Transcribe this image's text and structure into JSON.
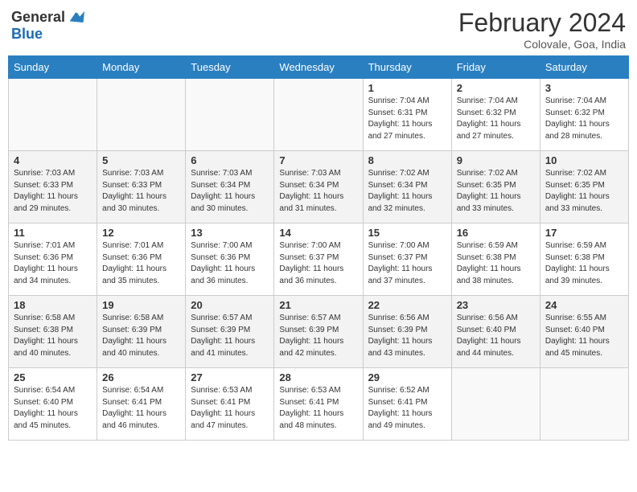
{
  "header": {
    "logo_general": "General",
    "logo_blue": "Blue",
    "month_year": "February 2024",
    "location": "Colovale, Goa, India"
  },
  "days_of_week": [
    "Sunday",
    "Monday",
    "Tuesday",
    "Wednesday",
    "Thursday",
    "Friday",
    "Saturday"
  ],
  "weeks": [
    [
      {
        "day": "",
        "info": ""
      },
      {
        "day": "",
        "info": ""
      },
      {
        "day": "",
        "info": ""
      },
      {
        "day": "",
        "info": ""
      },
      {
        "day": "1",
        "info": "Sunrise: 7:04 AM\nSunset: 6:31 PM\nDaylight: 11 hours and 27 minutes."
      },
      {
        "day": "2",
        "info": "Sunrise: 7:04 AM\nSunset: 6:32 PM\nDaylight: 11 hours and 27 minutes."
      },
      {
        "day": "3",
        "info": "Sunrise: 7:04 AM\nSunset: 6:32 PM\nDaylight: 11 hours and 28 minutes."
      }
    ],
    [
      {
        "day": "4",
        "info": "Sunrise: 7:03 AM\nSunset: 6:33 PM\nDaylight: 11 hours and 29 minutes."
      },
      {
        "day": "5",
        "info": "Sunrise: 7:03 AM\nSunset: 6:33 PM\nDaylight: 11 hours and 30 minutes."
      },
      {
        "day": "6",
        "info": "Sunrise: 7:03 AM\nSunset: 6:34 PM\nDaylight: 11 hours and 30 minutes."
      },
      {
        "day": "7",
        "info": "Sunrise: 7:03 AM\nSunset: 6:34 PM\nDaylight: 11 hours and 31 minutes."
      },
      {
        "day": "8",
        "info": "Sunrise: 7:02 AM\nSunset: 6:34 PM\nDaylight: 11 hours and 32 minutes."
      },
      {
        "day": "9",
        "info": "Sunrise: 7:02 AM\nSunset: 6:35 PM\nDaylight: 11 hours and 33 minutes."
      },
      {
        "day": "10",
        "info": "Sunrise: 7:02 AM\nSunset: 6:35 PM\nDaylight: 11 hours and 33 minutes."
      }
    ],
    [
      {
        "day": "11",
        "info": "Sunrise: 7:01 AM\nSunset: 6:36 PM\nDaylight: 11 hours and 34 minutes."
      },
      {
        "day": "12",
        "info": "Sunrise: 7:01 AM\nSunset: 6:36 PM\nDaylight: 11 hours and 35 minutes."
      },
      {
        "day": "13",
        "info": "Sunrise: 7:00 AM\nSunset: 6:36 PM\nDaylight: 11 hours and 36 minutes."
      },
      {
        "day": "14",
        "info": "Sunrise: 7:00 AM\nSunset: 6:37 PM\nDaylight: 11 hours and 36 minutes."
      },
      {
        "day": "15",
        "info": "Sunrise: 7:00 AM\nSunset: 6:37 PM\nDaylight: 11 hours and 37 minutes."
      },
      {
        "day": "16",
        "info": "Sunrise: 6:59 AM\nSunset: 6:38 PM\nDaylight: 11 hours and 38 minutes."
      },
      {
        "day": "17",
        "info": "Sunrise: 6:59 AM\nSunset: 6:38 PM\nDaylight: 11 hours and 39 minutes."
      }
    ],
    [
      {
        "day": "18",
        "info": "Sunrise: 6:58 AM\nSunset: 6:38 PM\nDaylight: 11 hours and 40 minutes."
      },
      {
        "day": "19",
        "info": "Sunrise: 6:58 AM\nSunset: 6:39 PM\nDaylight: 11 hours and 40 minutes."
      },
      {
        "day": "20",
        "info": "Sunrise: 6:57 AM\nSunset: 6:39 PM\nDaylight: 11 hours and 41 minutes."
      },
      {
        "day": "21",
        "info": "Sunrise: 6:57 AM\nSunset: 6:39 PM\nDaylight: 11 hours and 42 minutes."
      },
      {
        "day": "22",
        "info": "Sunrise: 6:56 AM\nSunset: 6:39 PM\nDaylight: 11 hours and 43 minutes."
      },
      {
        "day": "23",
        "info": "Sunrise: 6:56 AM\nSunset: 6:40 PM\nDaylight: 11 hours and 44 minutes."
      },
      {
        "day": "24",
        "info": "Sunrise: 6:55 AM\nSunset: 6:40 PM\nDaylight: 11 hours and 45 minutes."
      }
    ],
    [
      {
        "day": "25",
        "info": "Sunrise: 6:54 AM\nSunset: 6:40 PM\nDaylight: 11 hours and 45 minutes."
      },
      {
        "day": "26",
        "info": "Sunrise: 6:54 AM\nSunset: 6:41 PM\nDaylight: 11 hours and 46 minutes."
      },
      {
        "day": "27",
        "info": "Sunrise: 6:53 AM\nSunset: 6:41 PM\nDaylight: 11 hours and 47 minutes."
      },
      {
        "day": "28",
        "info": "Sunrise: 6:53 AM\nSunset: 6:41 PM\nDaylight: 11 hours and 48 minutes."
      },
      {
        "day": "29",
        "info": "Sunrise: 6:52 AM\nSunset: 6:41 PM\nDaylight: 11 hours and 49 minutes."
      },
      {
        "day": "",
        "info": ""
      },
      {
        "day": "",
        "info": ""
      }
    ]
  ]
}
